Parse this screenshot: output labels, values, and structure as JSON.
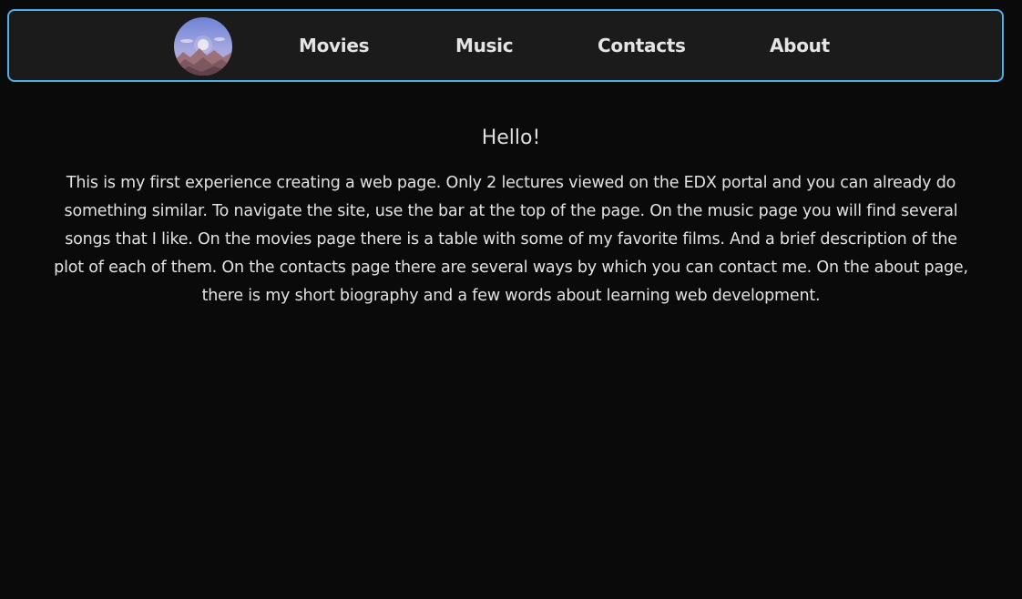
{
  "nav": {
    "logo": "avatar-landscape",
    "links": [
      {
        "label": "Movies",
        "icon": ""
      },
      {
        "label": "Music",
        "icon": ""
      },
      {
        "label": "Contacts",
        "icon": ""
      },
      {
        "label": "About",
        "icon": ""
      }
    ],
    "border_color": "#4fb0e8",
    "background": "#1b1b1b"
  },
  "main": {
    "heading": "Hello!",
    "text": "This is my first experience creating a web page. Only 2 lectures viewed on the EDX portal and you can already do something similar. To navigate the site, use the bar at the top of the page. On the music page you will find several songs that I like. On the movies page there is a table with some of my favorite films. And a brief description of the plot of each of them. On the contacts page there are several ways by which you can contact me. On the about page, there is my short biography and a few words about learning web development."
  },
  "colors": {
    "page_background": "#0a0a0a",
    "text": "#e2e2e2"
  }
}
